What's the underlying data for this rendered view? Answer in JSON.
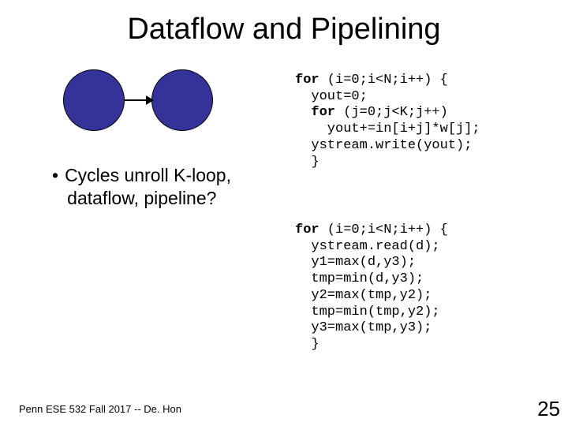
{
  "title": "Dataflow and Pipelining",
  "bullet": {
    "line1": "Cycles unroll K-loop,",
    "line2": "dataflow, pipeline?"
  },
  "code1": {
    "l1a": "for",
    "l1b": " (i=0;i<N;i++) {",
    "l2": "  yout=0;",
    "l3a": "  ",
    "l3b": "for",
    "l3c": " (j=0;j<K;j++)",
    "l4": "    yout+=in[i+j]*w[j];",
    "l5": "  ystream.write(yout);",
    "l6": "  }"
  },
  "code2": {
    "l1a": "for",
    "l1b": " (i=0;i<N;i++) {",
    "l2": "  ystream.read(d);",
    "l3": "  y1=max(d,y3);",
    "l4": "  tmp=min(d,y3);",
    "l5": "  y2=max(tmp,y2);",
    "l6": "  tmp=min(tmp,y2);",
    "l7": "  y3=max(tmp,y3);",
    "l8": "  }"
  },
  "footer": "Penn ESE 532 Fall 2017 -- De. Hon",
  "pagenum": "25"
}
